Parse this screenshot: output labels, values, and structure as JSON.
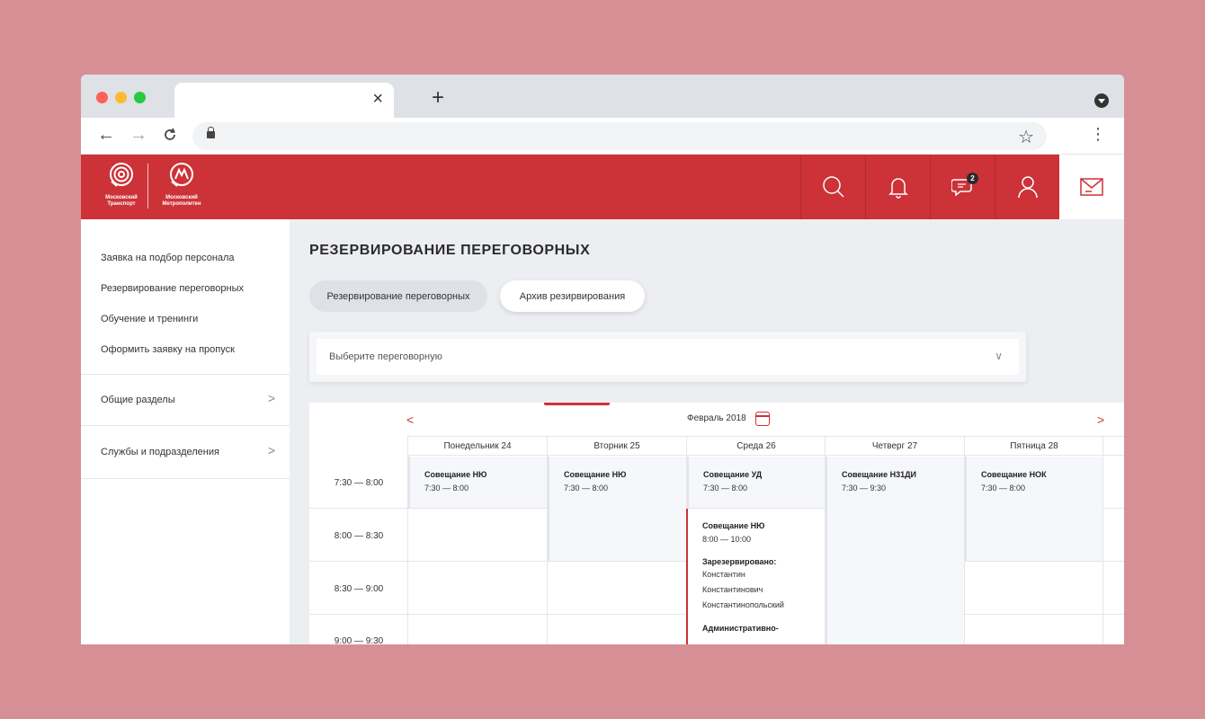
{
  "browser": {
    "tab_close": "×",
    "new_tab": "+",
    "back": "←",
    "forward": "→",
    "reload": "C",
    "star": "☆",
    "menu": "⋮",
    "dot_colors": [
      "#fe5f57",
      "#febb2e",
      "#28c840"
    ]
  },
  "header": {
    "logo1_text": "Московский\nТранспорт",
    "logo2_text": "Московский\nМетрополитен",
    "chat_badge": "2",
    "brand_color": "#cc3238"
  },
  "sidebar": {
    "items": [
      "Заявка на подбор персонала",
      "Резервирование переговорных",
      "Обучение и тренинги",
      "Оформить заявку на пропуск"
    ],
    "groups": [
      "Общие разделы",
      "Службы и подразделения"
    ],
    "chevron": ">"
  },
  "main": {
    "title": "РЕЗЕРВИРОВАНИЕ ПЕРЕГОВОРНЫХ",
    "tabs": [
      "Резервирование переговорных",
      "Архив резирвирования"
    ],
    "select_placeholder": "Выберите переговорную",
    "select_chevron": "∨"
  },
  "calendar": {
    "month": "Февраль 2018",
    "prev": "<",
    "next": ">",
    "days": [
      "Понедельник 24",
      "Вторник 25",
      "Среда 26",
      "Четверг 27",
      "Пятница 28"
    ],
    "times": [
      "7:30 — 8:00",
      "8:00 — 8:30",
      "8:30 — 9:00",
      "9:00 — 9:30"
    ],
    "events": [
      {
        "title": "Совещание НЮ",
        "time": "7:30 — 8:00"
      },
      {
        "title": "Совещание НЮ",
        "time": "7:30 — 8:00"
      },
      {
        "title": "Совещание УД",
        "time": "7:30 — 8:00"
      },
      {
        "title": "Совещание Н31ДИ",
        "time": "7:30 — 9:30"
      },
      {
        "title": "Совещание НОК",
        "time": "7:30 — 8:00"
      }
    ],
    "active_event": {
      "title": "Совещание НЮ",
      "time": "8:00 — 10:00",
      "reserved_label": "Зарезервировано:",
      "person_line1": "Константин",
      "person_line2": "Константинович",
      "person_line3": "Константинопольский",
      "dept": "Административно-"
    }
  }
}
